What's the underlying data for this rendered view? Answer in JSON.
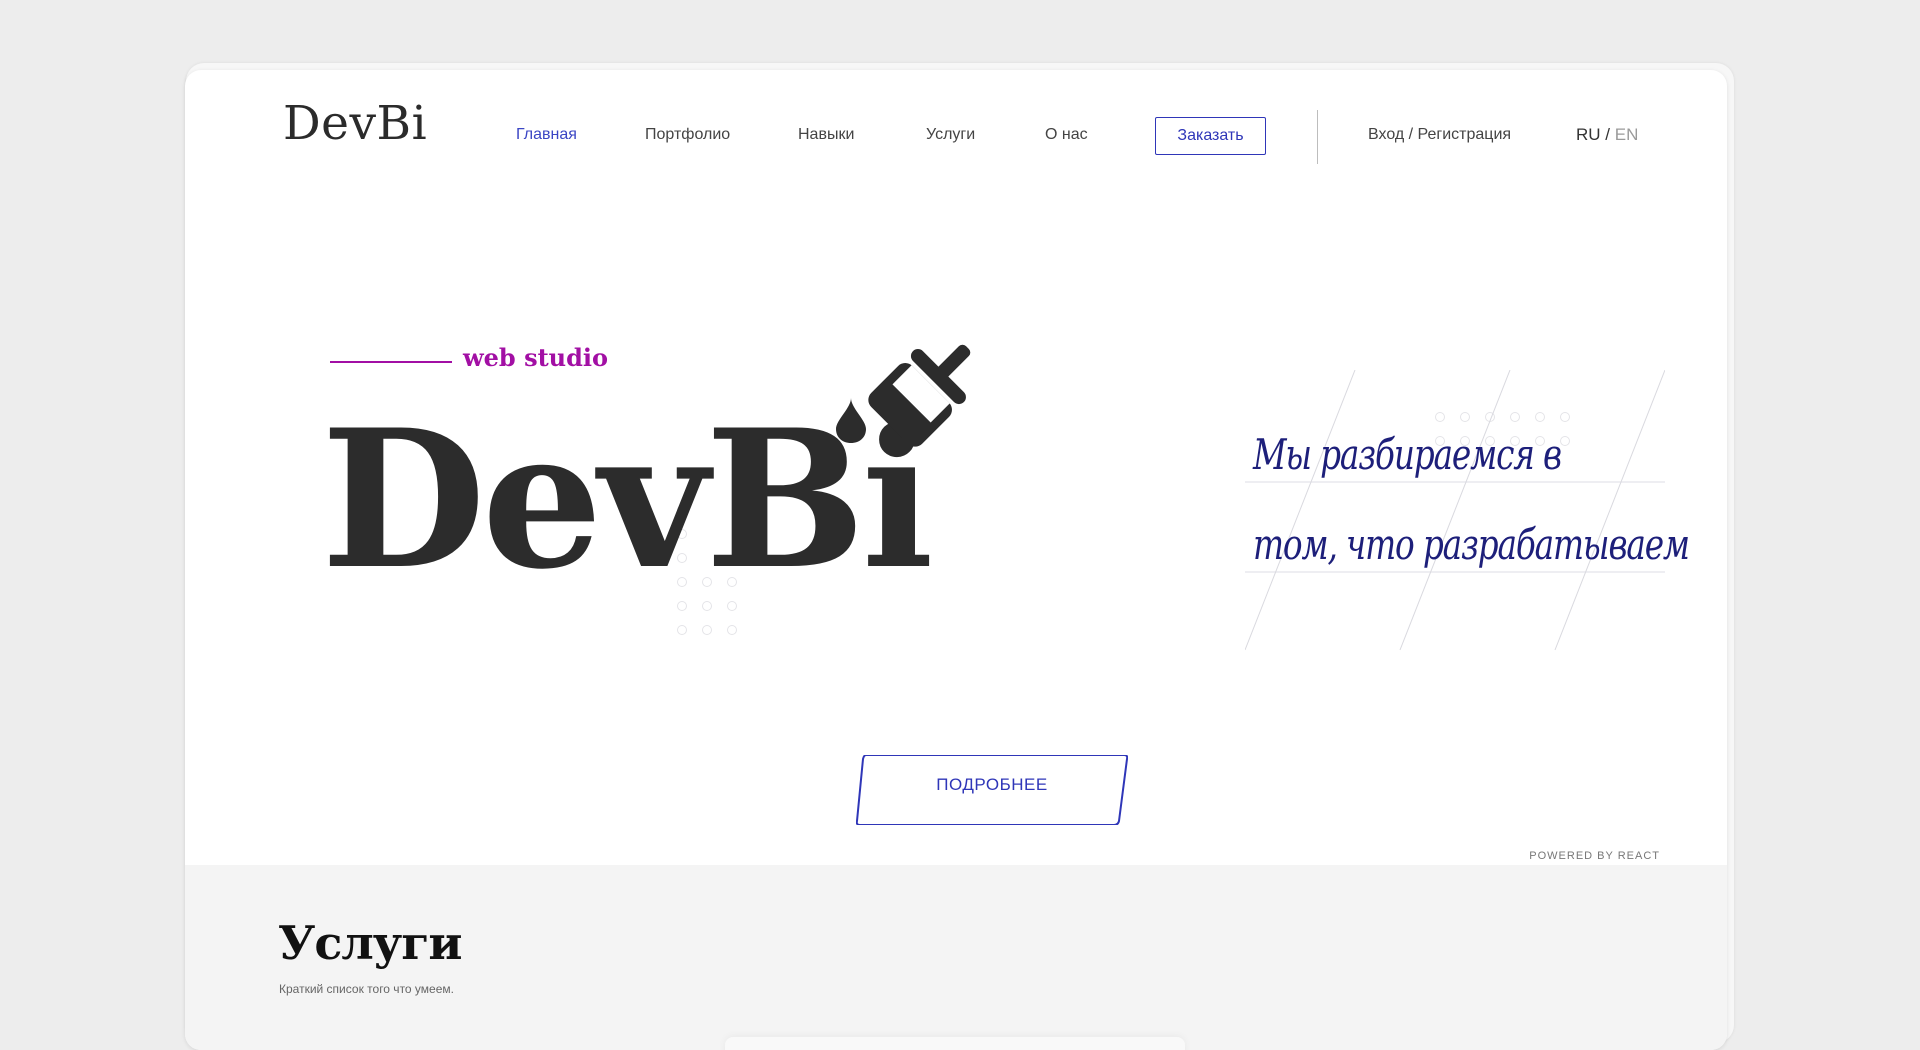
{
  "nav": {
    "logo": "DevBi",
    "items": [
      {
        "label": "Главная",
        "active": true
      },
      {
        "label": "Портфолио",
        "active": false
      },
      {
        "label": "Навыки",
        "active": false
      },
      {
        "label": "Услуги",
        "active": false
      },
      {
        "label": "О нас",
        "active": false
      }
    ],
    "order_label": "Заказать",
    "login_label": "Вход / Регистрация",
    "lang": {
      "ru": "RU",
      "sep": "/",
      "en": "EN",
      "active": "RU"
    }
  },
  "hero": {
    "tagline": "web studio",
    "logo": "DevBi",
    "slogan_line1": "Мы разбираемся в",
    "slogan_line2": "том, что разрабатываем",
    "more_label": "ПОДРОБНЕЕ",
    "powered": "POWERED BY REACT",
    "icons": [
      "paint-brush-icon",
      "drop-icon"
    ]
  },
  "services": {
    "title": "Услуги",
    "subtitle": "Краткий список того что умеем."
  },
  "colors": {
    "accent": "#2f36b8",
    "magenta": "#a20fa4",
    "slogan": "#1d1f7a",
    "logo": "#2c2c2c"
  }
}
